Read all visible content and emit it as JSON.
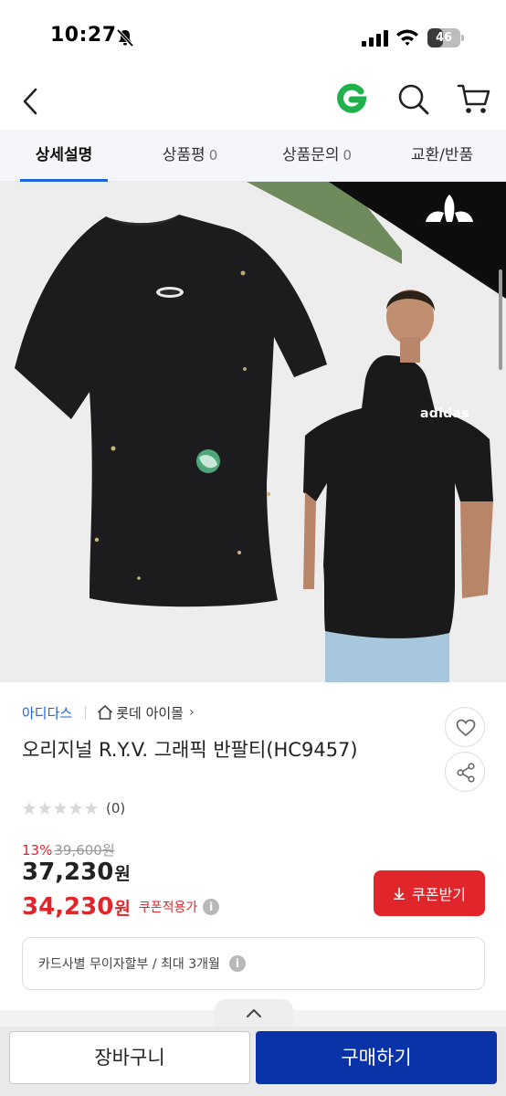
{
  "status_bar": {
    "time": "10:27",
    "battery_text": "46",
    "battery_level": 0.46,
    "icons": [
      "bell-slash-icon",
      "signal-icon",
      "wifi-icon",
      "battery-icon"
    ]
  },
  "header": {
    "icons": [
      "back-arrow-icon",
      "g-logo",
      "search-icon",
      "cart-icon"
    ],
    "logo_color": "#1fb14a"
  },
  "tabs": [
    {
      "label": "상세설명",
      "count": "",
      "active": true
    },
    {
      "label": "상품평",
      "count": "0",
      "active": false
    },
    {
      "label": "상품문의",
      "count": "0",
      "active": false
    },
    {
      "label": "교환/반품",
      "count": "",
      "active": false
    }
  ],
  "product_image": {
    "brand_badge": "adidas"
  },
  "product": {
    "brand": "아디다스",
    "store": "롯데 아이몰",
    "store_chevron": "›",
    "title": "오리지널 R.Y.V. 그래픽 반팔티(HC9457)",
    "review_count": "(0)",
    "rating": 0,
    "discount_rate": "13%",
    "original_price": "39,600원",
    "price": "37,230",
    "price_unit": "원",
    "coupon_price": "34,230",
    "coupon_price_unit": "원",
    "coupon_label": "쿠폰적용가",
    "coupon_button": "쿠폰받기",
    "installment": "카드사별 무이자할부 / 최대 3개월",
    "info_glyph": "i"
  },
  "bottom_bar": {
    "cart_label": "장바구니",
    "buy_label": "구매하기"
  },
  "colors": {
    "accent_blue": "#1b64da",
    "sale_red": "#e0262b",
    "buy_blue": "#0b33a8"
  }
}
